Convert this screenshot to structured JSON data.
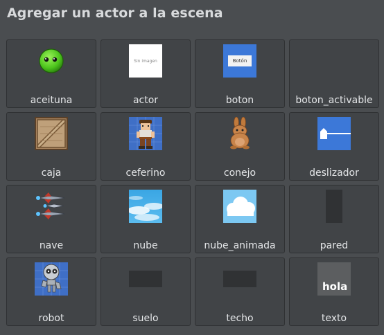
{
  "dialog": {
    "title": "Agregar un actor a la escena"
  },
  "actors": [
    {
      "label": "aceituna",
      "icon": "aceituna-icon"
    },
    {
      "label": "actor",
      "icon": "image-placeholder-icon",
      "thumb_text": "Sin imagen"
    },
    {
      "label": "boton",
      "icon": "button-icon",
      "thumb_text": "Botón"
    },
    {
      "label": "boton_activable",
      "icon": "blank-icon"
    },
    {
      "label": "caja",
      "icon": "crate-icon"
    },
    {
      "label": "ceferino",
      "icon": "ceferino-icon"
    },
    {
      "label": "conejo",
      "icon": "rabbit-icon"
    },
    {
      "label": "deslizador",
      "icon": "slider-icon"
    },
    {
      "label": "nave",
      "icon": "spaceship-icon"
    },
    {
      "label": "nube",
      "icon": "cloud-texture-icon"
    },
    {
      "label": "nube_animada",
      "icon": "cloud-icon"
    },
    {
      "label": "pared",
      "icon": "wall-icon"
    },
    {
      "label": "robot",
      "icon": "robot-icon"
    },
    {
      "label": "suelo",
      "icon": "floor-icon"
    },
    {
      "label": "techo",
      "icon": "ceiling-icon"
    },
    {
      "label": "texto",
      "icon": "text-icon",
      "thumb_text": "hola m"
    }
  ]
}
